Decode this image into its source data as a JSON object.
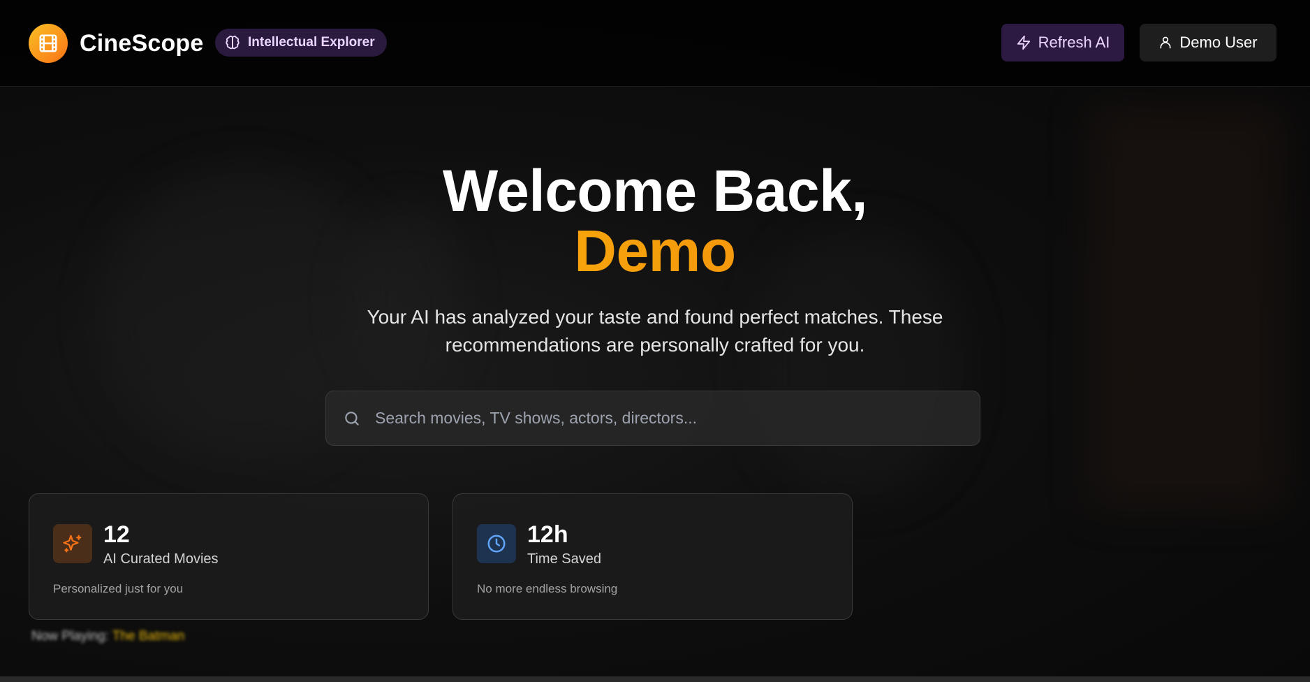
{
  "header": {
    "app_name": "CineScope",
    "persona_badge": "Intellectual Explorer",
    "refresh_label": "Refresh AI",
    "user_label": "Demo User"
  },
  "hero": {
    "greeting": "Welcome Back,",
    "name": "Demo",
    "subtitle": "Your AI has analyzed your taste and found perfect matches. These recommendations are personally crafted for you."
  },
  "search": {
    "placeholder": "Search movies, TV shows, actors, directors...",
    "value": ""
  },
  "stats": [
    {
      "value": "12",
      "label": "AI Curated Movies",
      "description": "Personalized just for you",
      "icon": "sparkles-icon",
      "color": "#f97316"
    },
    {
      "value": "12h",
      "label": "Time Saved",
      "description": "No more endless browsing",
      "icon": "clock-icon",
      "color": "#60a5fa"
    }
  ],
  "now_playing": {
    "label": "Now Playing:",
    "title": "The Batman"
  },
  "colors": {
    "accent_gradient_start": "#facc15",
    "accent_gradient_end": "#f97316",
    "persona_purple": "#e9d5ff",
    "background": "#050505"
  },
  "icons": {
    "logo": "film-icon",
    "persona": "brain-icon",
    "refresh": "lightning-icon",
    "user": "user-icon",
    "search": "search-icon"
  }
}
